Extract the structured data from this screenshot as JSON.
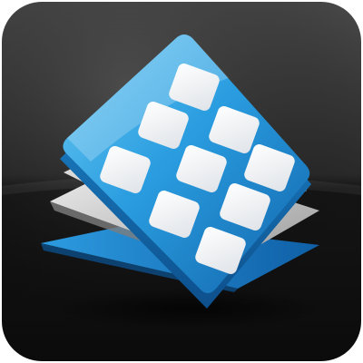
{
  "icon": {
    "name": "app-grid-icon",
    "colors": {
      "background_top": "#4a4a4a",
      "background_bottom": "#0d0d0d",
      "tile_light": "#5ec1ef",
      "tile_dark": "#1678c2",
      "page_light": "#e6e6e6",
      "page_dark": "#a9a9a9",
      "base_blue": "#1a86cf",
      "cell": "#f4f5f7"
    },
    "grid": {
      "rows": 3,
      "cols": 3
    }
  }
}
